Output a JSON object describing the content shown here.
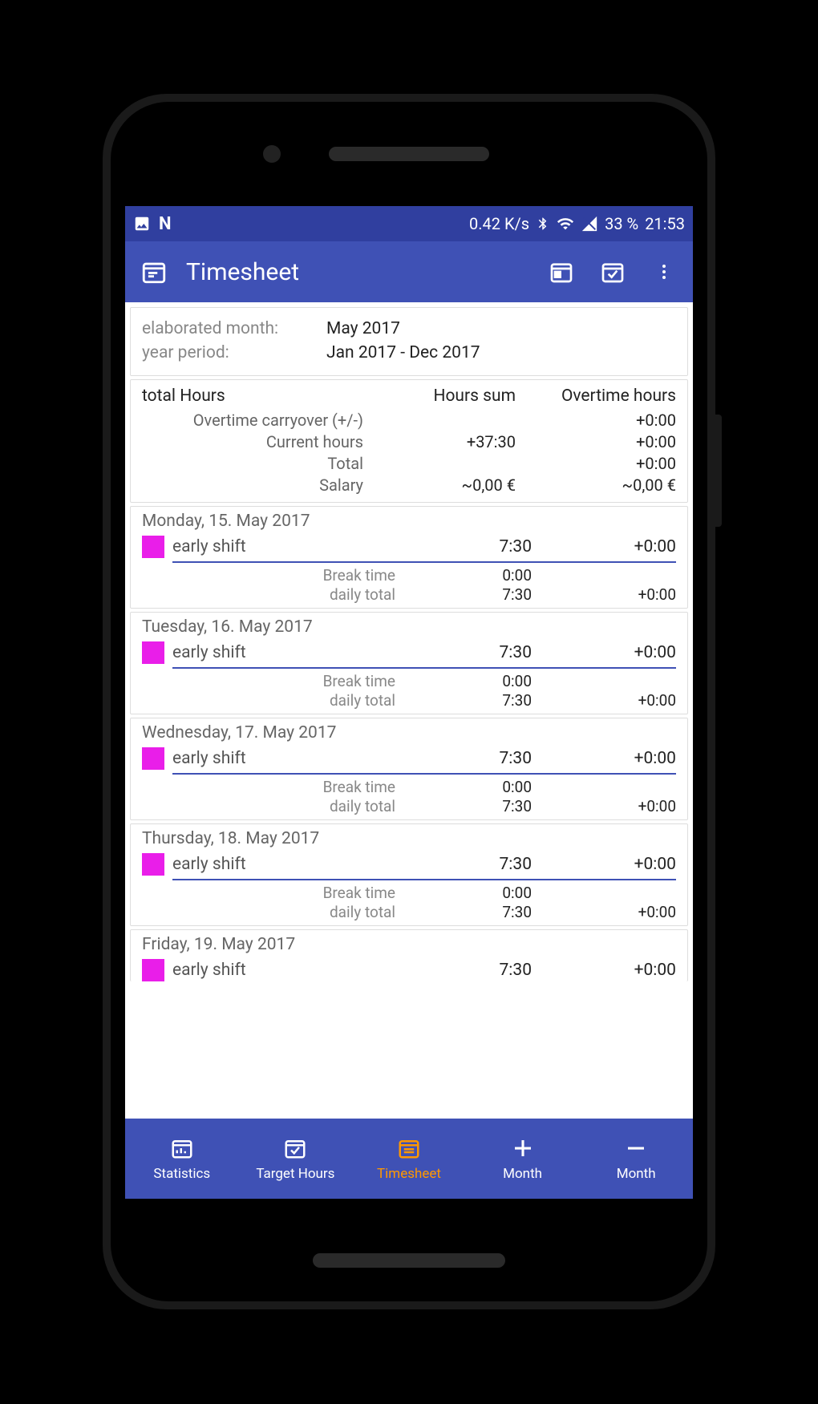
{
  "status": {
    "speed": "0.42 K/s",
    "battery": "33 %",
    "time": "21:53"
  },
  "appbar": {
    "title": "Timesheet"
  },
  "info": {
    "elaborated_label": "elaborated month:",
    "elaborated_value": "May 2017",
    "period_label": "year period:",
    "period_value": "Jan 2017 - Dec 2017"
  },
  "totals": {
    "title": "total Hours",
    "col_mid": "Hours sum",
    "col_right": "Overtime hours",
    "rows": [
      {
        "label": "Overtime carryover (+/-)",
        "mid": "",
        "right": "+0:00"
      },
      {
        "label": "Current hours",
        "mid": "+37:30",
        "right": "+0:00"
      },
      {
        "label": "Total",
        "mid": "",
        "right": "+0:00"
      },
      {
        "label": "Salary",
        "mid": "~0,00 €",
        "right": "~0,00 €"
      }
    ]
  },
  "days": [
    {
      "date": "Monday, 15. May 2017",
      "shift": "early shift",
      "hours": "7:30",
      "ot": "+0:00",
      "break_label": "Break time",
      "break": "0:00",
      "total_label": "daily total",
      "total": "7:30",
      "total_ot": "+0:00"
    },
    {
      "date": "Tuesday, 16. May 2017",
      "shift": "early shift",
      "hours": "7:30",
      "ot": "+0:00",
      "break_label": "Break time",
      "break": "0:00",
      "total_label": "daily total",
      "total": "7:30",
      "total_ot": "+0:00"
    },
    {
      "date": "Wednesday, 17. May 2017",
      "shift": "early shift",
      "hours": "7:30",
      "ot": "+0:00",
      "break_label": "Break time",
      "break": "0:00",
      "total_label": "daily total",
      "total": "7:30",
      "total_ot": "+0:00"
    },
    {
      "date": "Thursday, 18. May 2017",
      "shift": "early shift",
      "hours": "7:30",
      "ot": "+0:00",
      "break_label": "Break time",
      "break": "0:00",
      "total_label": "daily total",
      "total": "7:30",
      "total_ot": "+0:00"
    },
    {
      "date": "Friday, 19. May 2017",
      "shift": "early shift",
      "hours": "7:30",
      "ot": "+0:00"
    }
  ],
  "nav": {
    "items": [
      {
        "label": "Statistics"
      },
      {
        "label": "Target Hours"
      },
      {
        "label": "Timesheet"
      },
      {
        "label": "Month"
      },
      {
        "label": "Month"
      }
    ]
  }
}
